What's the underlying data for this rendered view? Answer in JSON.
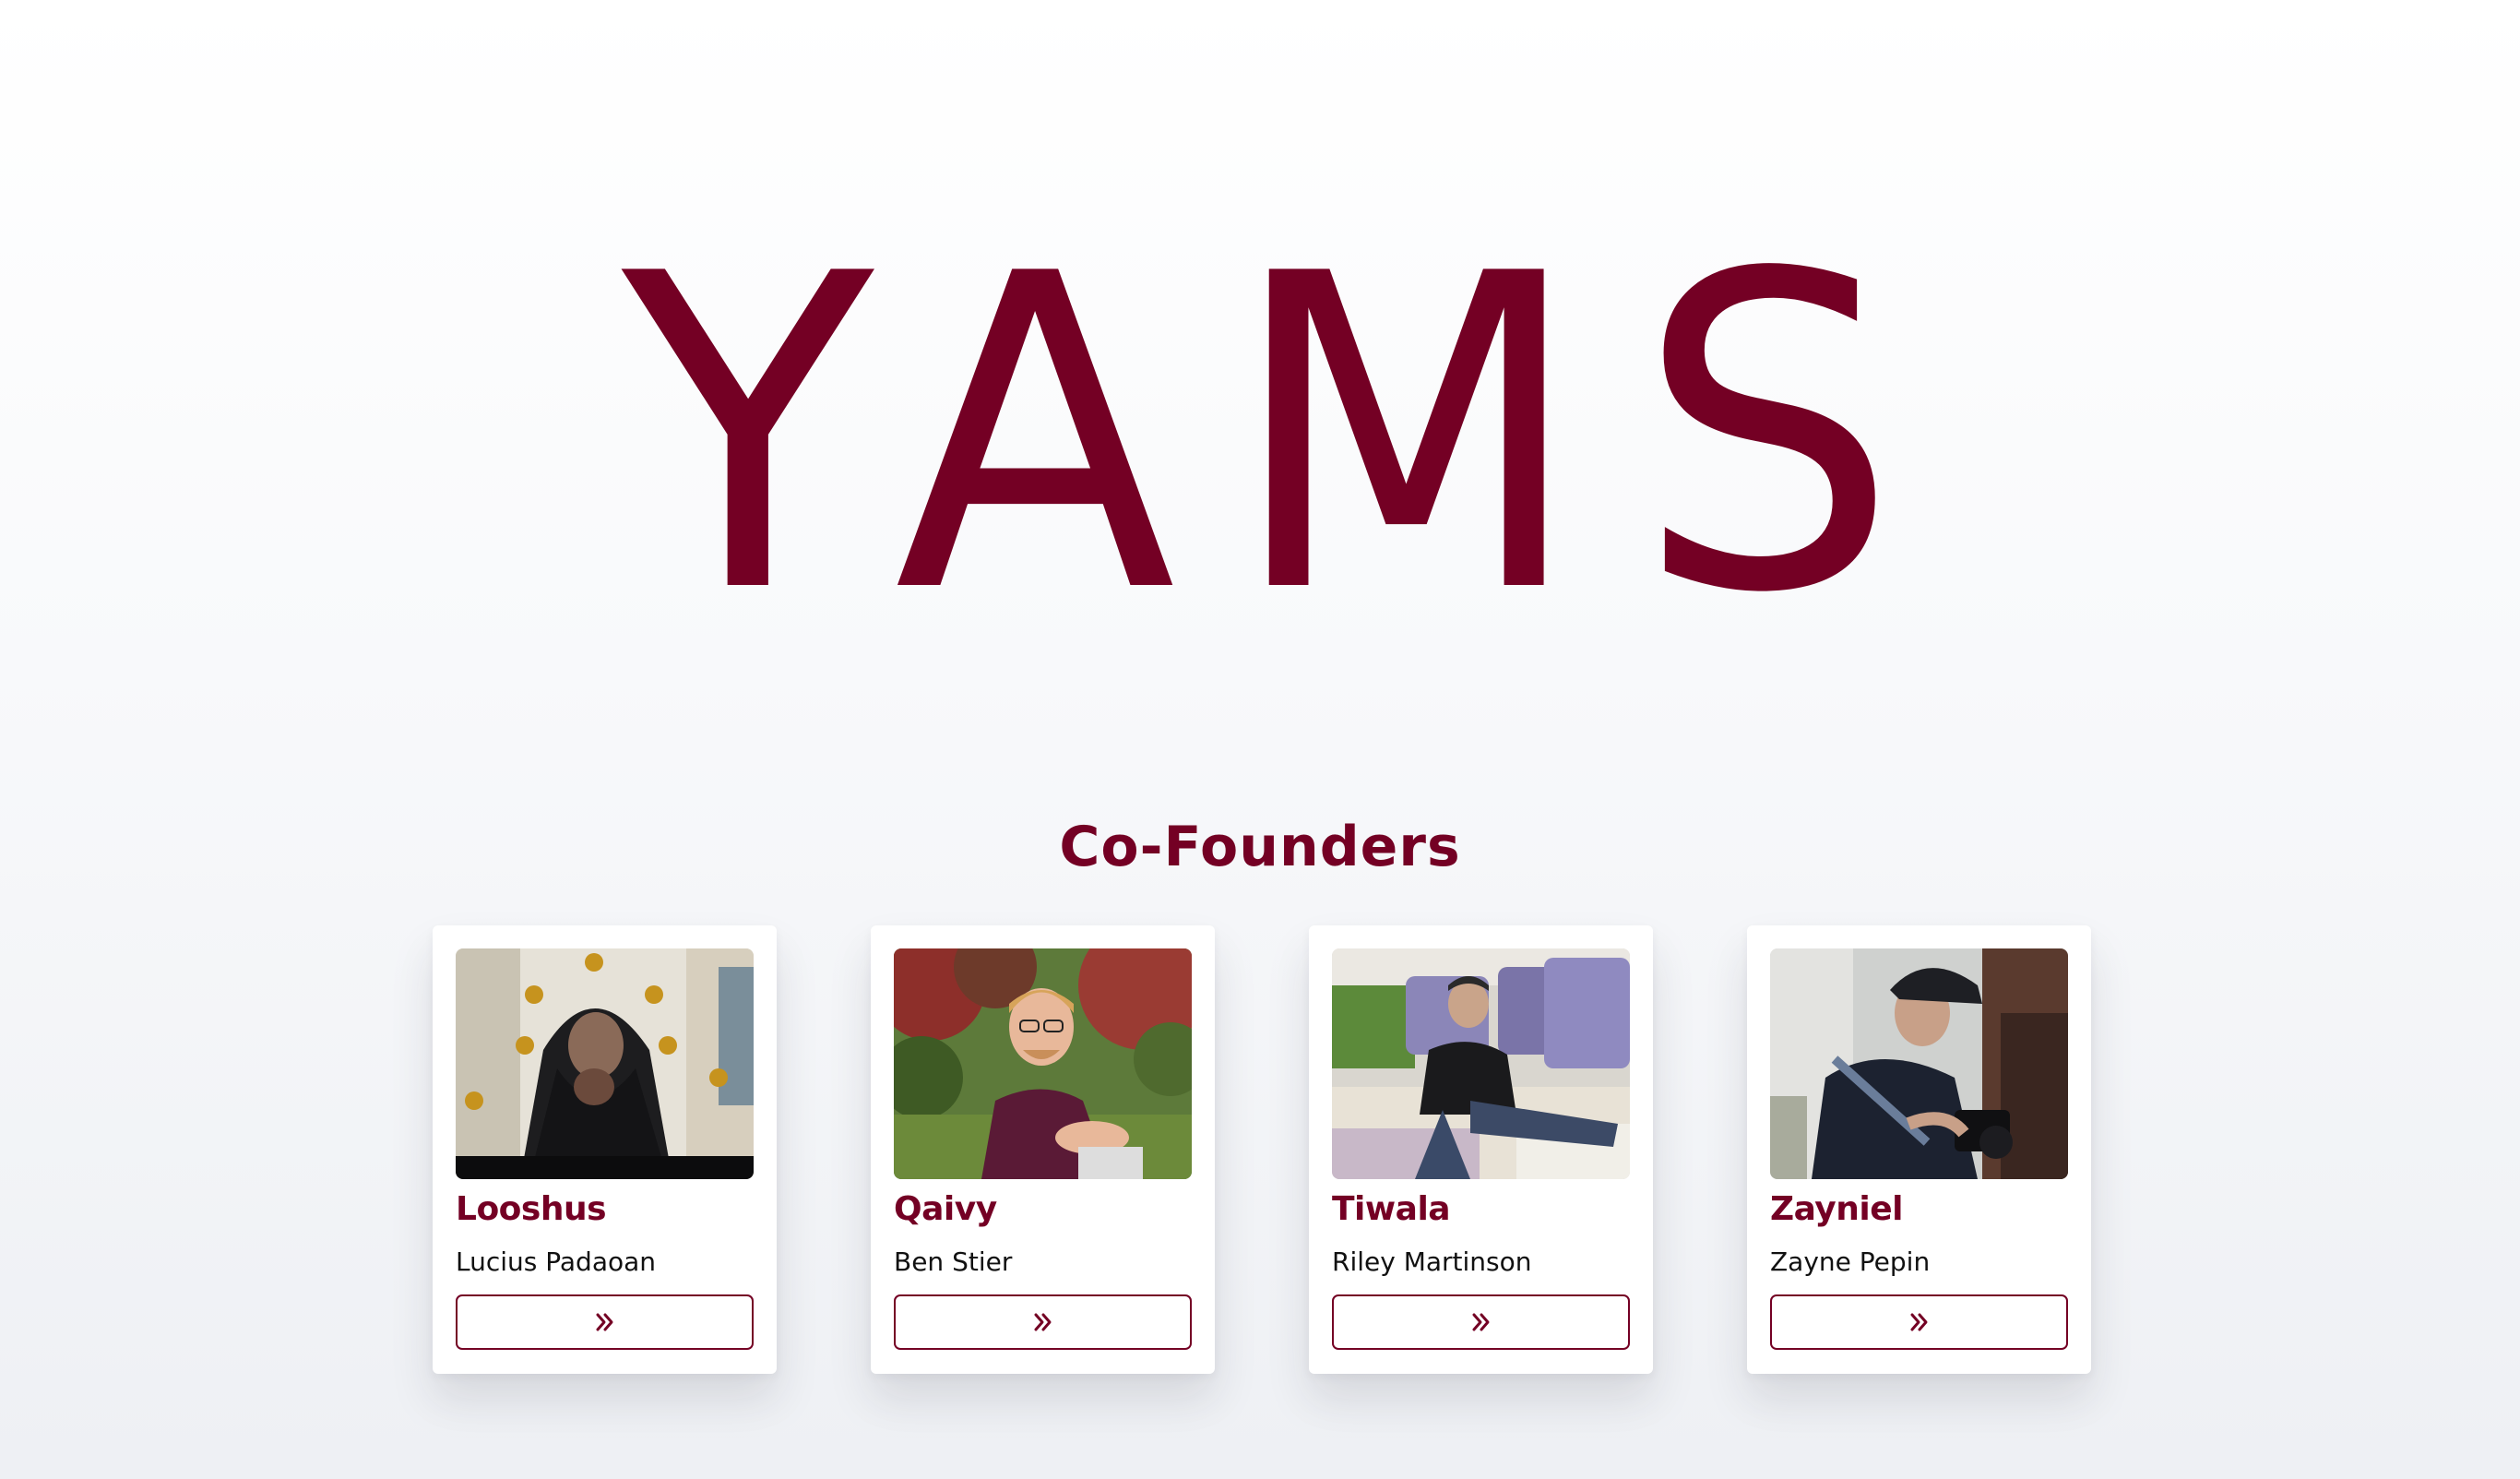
{
  "brand": {
    "title": "YAMS",
    "accent_color": "#740024"
  },
  "section": {
    "title": "Co-Founders"
  },
  "founders": [
    {
      "alias": "Looshus",
      "name": "Lucius Padaoan",
      "photo_description_icon": "photo-looshus",
      "button_icon": "double-chevron-right-icon"
    },
    {
      "alias": "Qaivy",
      "name": "Ben Stier",
      "photo_description_icon": "photo-qaivy",
      "button_icon": "double-chevron-right-icon"
    },
    {
      "alias": "Tiwala",
      "name": "Riley Martinson",
      "photo_description_icon": "photo-tiwala",
      "button_icon": "double-chevron-right-icon"
    },
    {
      "alias": "Zayniel",
      "name": "Zayne Pepin",
      "photo_description_icon": "photo-zayniel",
      "button_icon": "double-chevron-right-icon"
    }
  ]
}
